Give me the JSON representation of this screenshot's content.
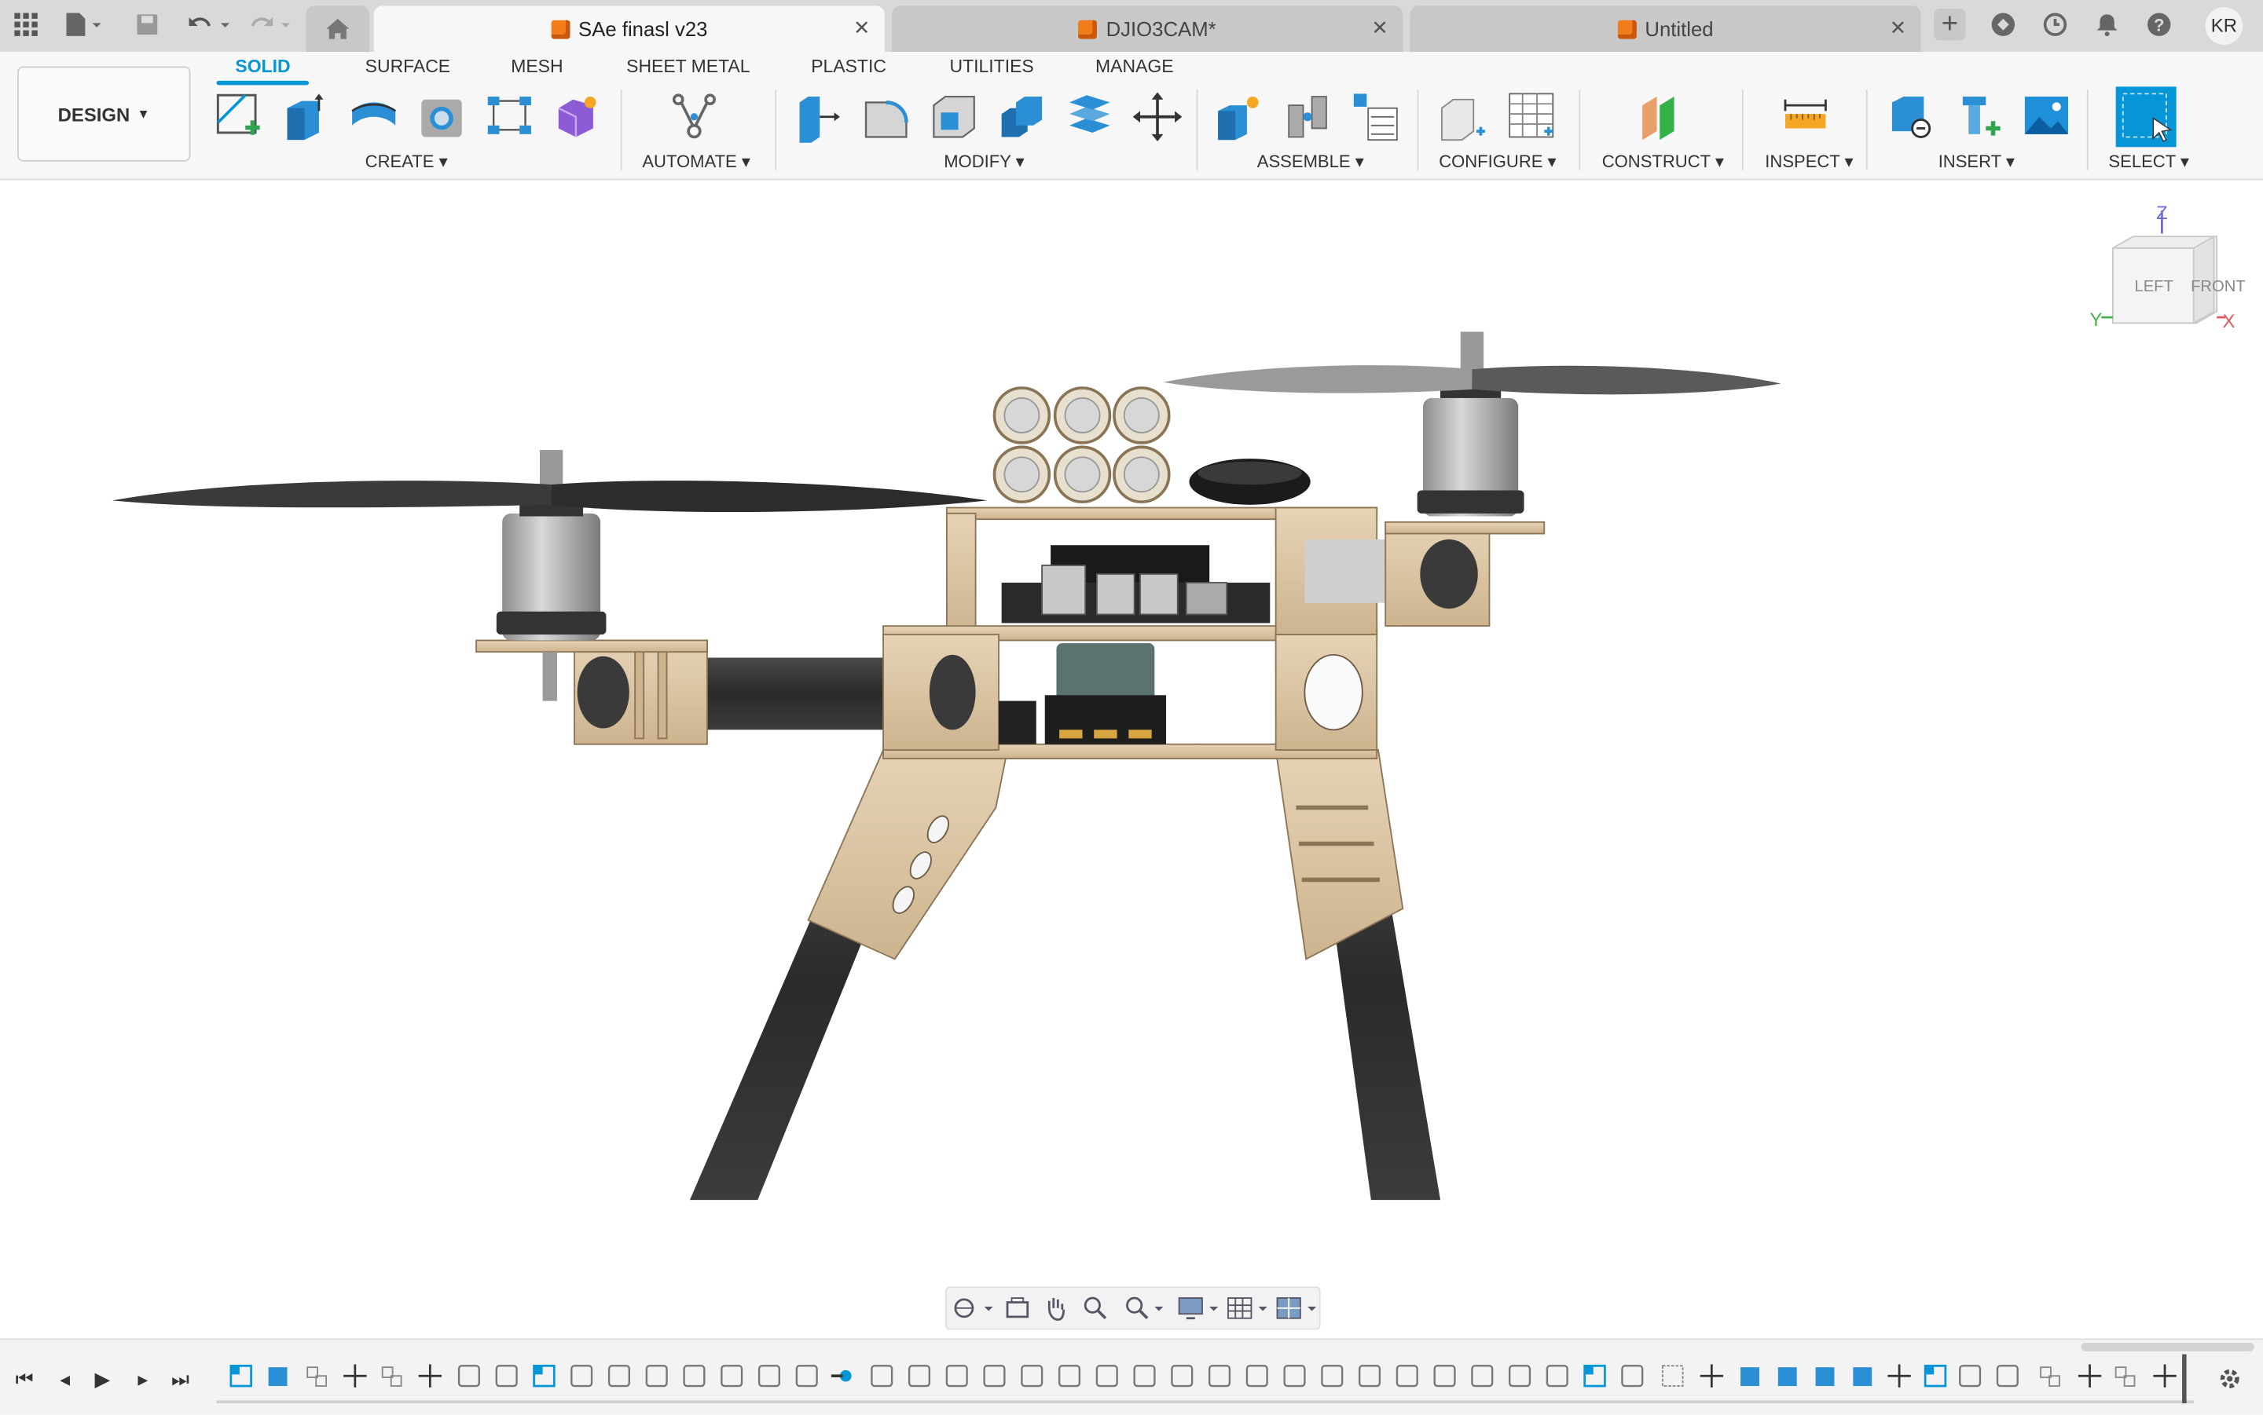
{
  "tabs": [
    {
      "label": "SAe finasl v23",
      "active": true
    },
    {
      "label": "DJIO3CAM*",
      "active": false
    },
    {
      "label": "Untitled",
      "active": false
    }
  ],
  "user_initials": "KR",
  "workspace": {
    "label": "DESIGN"
  },
  "mode_tabs": [
    "SOLID",
    "SURFACE",
    "MESH",
    "SHEET METAL",
    "PLASTIC",
    "UTILITIES",
    "MANAGE"
  ],
  "active_mode_tab": "SOLID",
  "groups": {
    "create": "CREATE",
    "automate": "AUTOMATE",
    "modify": "MODIFY",
    "assemble": "ASSEMBLE",
    "configure": "CONFIGURE",
    "construct": "CONSTRUCT",
    "inspect": "INSPECT",
    "insert": "INSERT",
    "select": "SELECT"
  },
  "viewcube": {
    "left": "LEFT",
    "front": "FRONT",
    "z": "Z",
    "x": "X",
    "y": "Y"
  },
  "colors": {
    "accent": "#0696d7",
    "brand_orange": "#f07c1a"
  }
}
